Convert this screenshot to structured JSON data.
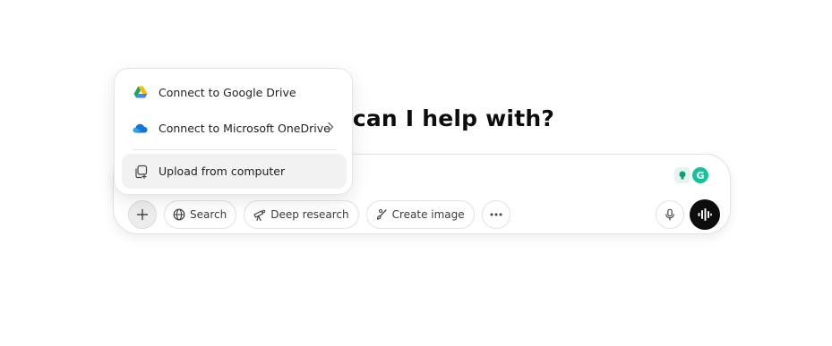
{
  "headline": "What can I help with?",
  "menu": {
    "items": [
      {
        "label": "Connect to Google Drive",
        "icon": "google-drive-icon"
      },
      {
        "label": "Connect to Microsoft OneDrive",
        "icon": "onedrive-icon",
        "has_submenu": true
      },
      {
        "label": "Upload from computer",
        "icon": "upload-file-icon"
      }
    ]
  },
  "toolbar": {
    "add_icon": "plus-icon",
    "search_label": "Search",
    "deep_research_label": "Deep research",
    "create_image_label": "Create image",
    "more_icon": "ellipsis-icon",
    "mic_icon": "microphone-icon",
    "voice_icon": "voice-mode-icon"
  },
  "extensions": {
    "grammarly_letter": "G"
  },
  "colors": {
    "accent_dark": "#0d0d0d",
    "grammarly": "#15c39a",
    "drive_green": "#1ea362",
    "drive_yellow": "#ffba00",
    "drive_blue": "#4285f4",
    "onedrive_blue": "#0f78d4"
  }
}
